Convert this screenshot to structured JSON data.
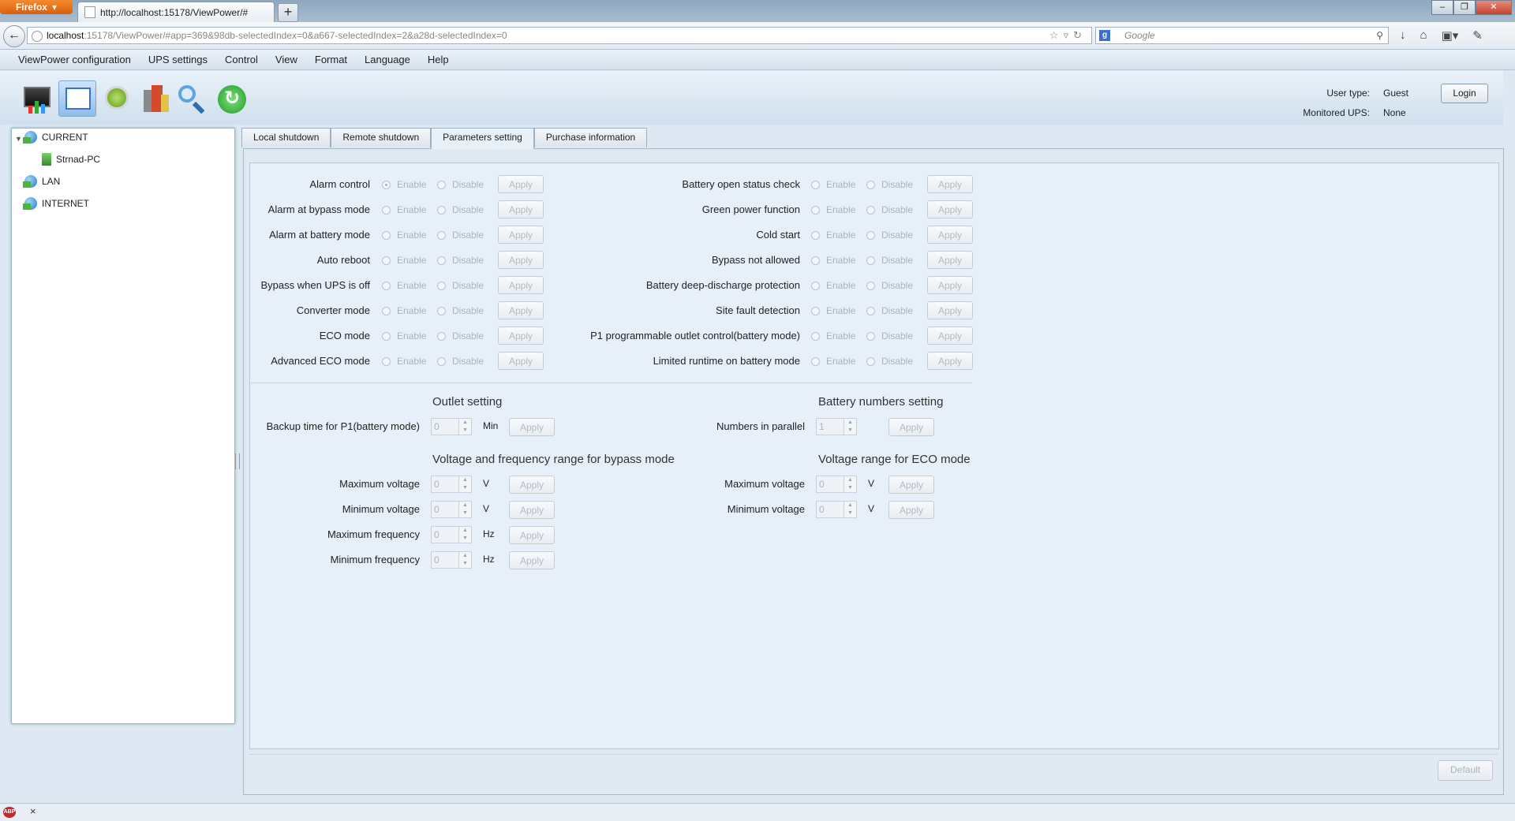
{
  "browser": {
    "menu_button": "Firefox",
    "tab_title": "http://localhost:15178/ViewPower/#",
    "url_host": "localhost",
    "url_rest": ":15178/ViewPower/#app=369&98db-selectedIndex=0&a667-selectedIndex=2&a28d-selectedIndex=0",
    "search_engine": "g",
    "search_placeholder": "Google"
  },
  "menu": [
    "ViewPower configuration",
    "UPS settings",
    "Control",
    "View",
    "Format",
    "Language",
    "Help"
  ],
  "toolbar_icons": [
    "monitor-icon",
    "configuration-icon",
    "gear-icon",
    "building-icon",
    "search-icon",
    "refresh-icon"
  ],
  "user": {
    "type_label": "User type:",
    "type_value": "Guest",
    "monitored_label": "Monitored UPS:",
    "monitored_value": "None",
    "login_label": "Login"
  },
  "tree": {
    "current": "CURRENT",
    "pc": "Strnad-PC",
    "lan": "LAN",
    "internet": "INTERNET"
  },
  "tabs": [
    "Local shutdown",
    "Remote shutdown",
    "Parameters setting",
    "Purchase information"
  ],
  "active_tab": "Parameters setting",
  "common": {
    "enable": "Enable",
    "disable": "Disable",
    "apply": "Apply",
    "default": "Default"
  },
  "left_params": [
    "Alarm control",
    "Alarm at bypass mode",
    "Alarm at battery mode",
    "Auto reboot",
    "Bypass when UPS is off",
    "Converter mode",
    "ECO mode",
    "Advanced ECO mode"
  ],
  "right_params": [
    "Battery open status check",
    "Green power function",
    "Cold start",
    "Bypass not allowed",
    "Battery deep-discharge protection",
    "Site fault detection",
    "P1 programmable outlet control(battery mode)",
    "Limited runtime on battery mode"
  ],
  "outlet": {
    "title": "Outlet setting",
    "backup_label": "Backup time for P1(battery mode)",
    "backup_value": "0",
    "backup_unit": "Min"
  },
  "battery": {
    "title": "Battery numbers setting",
    "parallel_label": "Numbers in parallel",
    "parallel_value": "1"
  },
  "bypass_range": {
    "title": "Voltage and frequency range for bypass mode",
    "max_voltage_label": "Maximum voltage",
    "min_voltage_label": "Minimum voltage",
    "max_freq_label": "Maximum frequency",
    "min_freq_label": "Minimum frequency",
    "max_voltage": "0",
    "min_voltage": "0",
    "max_freq": "0",
    "min_freq": "0",
    "volt_unit": "V",
    "freq_unit": "Hz"
  },
  "eco_range": {
    "title": "Voltage range for ECO mode",
    "max_voltage_label": "Maximum voltage",
    "min_voltage_label": "Minimum voltage",
    "max_voltage": "0",
    "min_voltage": "0",
    "volt_unit": "V"
  },
  "statusbar": {
    "close": "×"
  }
}
